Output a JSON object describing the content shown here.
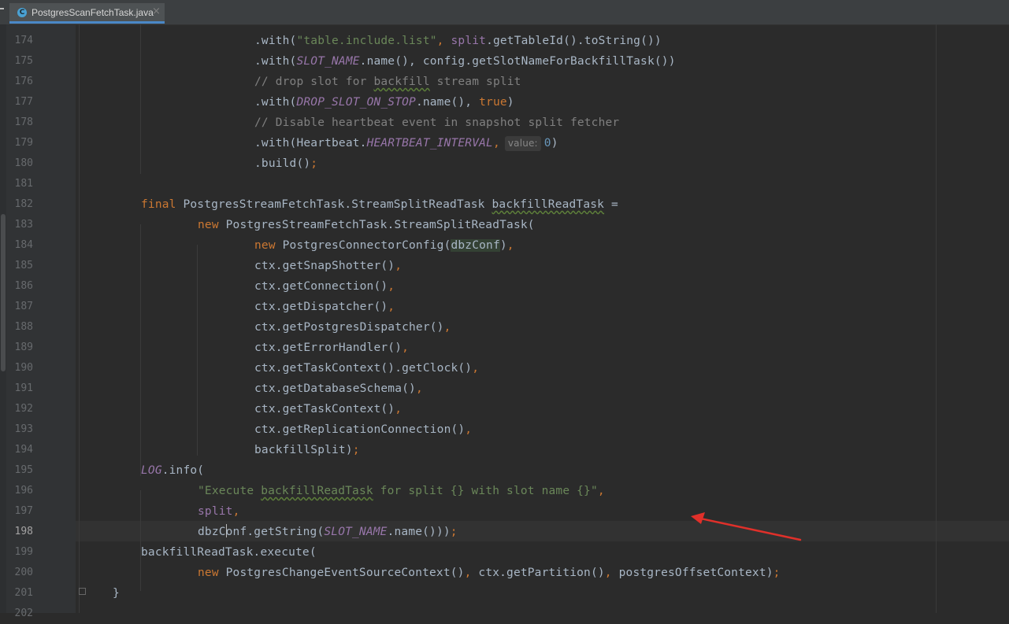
{
  "tab": {
    "title": "PostgresScanFetchTask.java",
    "close": "×",
    "icon_letter": "C"
  },
  "line_numbers": [
    "174",
    "175",
    "176",
    "177",
    "178",
    "179",
    "180",
    "181",
    "182",
    "183",
    "184",
    "185",
    "186",
    "187",
    "188",
    "189",
    "190",
    "191",
    "192",
    "193",
    "194",
    "195",
    "196",
    "197",
    "198",
    "199",
    "200",
    "201",
    "202"
  ],
  "current_line": "198",
  "code": {
    "l174": {
      "a": ".with(",
      "b": "\"table.include.list\"",
      "c": ", ",
      "d": "split",
      "e": ".getTableId().toString())"
    },
    "l175": {
      "a": ".with(",
      "b": "SLOT_NAME",
      "c": ".name(), config.getSlotNameForBackfillTask())"
    },
    "l176": {
      "a": "// drop slot for ",
      "b": "backfill",
      "c": " stream split"
    },
    "l177": {
      "a": ".with(",
      "b": "DROP_SLOT_ON_STOP",
      "c": ".name(), ",
      "d": "true",
      "e": ")"
    },
    "l178": {
      "a": "// Disable heartbeat event in snapshot split fetcher"
    },
    "l179": {
      "a": ".with(Heartbeat.",
      "b": "HEARTBEAT_INTERVAL",
      "c": ",",
      "hint": "value:",
      "d": "0",
      "e": ")"
    },
    "l180": {
      "a": ".build()",
      "b": ";"
    },
    "l182": {
      "a": "final ",
      "b": "PostgresStreamFetchTask.StreamSplitReadTask ",
      "c": "backfillReadTask",
      "d": " ="
    },
    "l183": {
      "a": "new ",
      "b": "PostgresStreamFetchTask.StreamSplitReadTask("
    },
    "l184": {
      "a": "new ",
      "b": "PostgresConnectorConfig(",
      "c": "dbzConf",
      "d": ")",
      "e": ","
    },
    "l185": {
      "a": "ctx.getSnapShotter()",
      "b": ","
    },
    "l186": {
      "a": "ctx.getConnection()",
      "b": ","
    },
    "l187": {
      "a": "ctx.getDispatcher()",
      "b": ","
    },
    "l188": {
      "a": "ctx.getPostgresDispatcher()",
      "b": ","
    },
    "l189": {
      "a": "ctx.getErrorHandler()",
      "b": ","
    },
    "l190": {
      "a": "ctx.getTaskContext().getClock()",
      "b": ","
    },
    "l191": {
      "a": "ctx.getDatabaseSchema()",
      "b": ","
    },
    "l192": {
      "a": "ctx.getTaskContext()",
      "b": ","
    },
    "l193": {
      "a": "ctx.getReplicationConnection()",
      "b": ","
    },
    "l194": {
      "a": "backfillSplit)",
      "b": ";"
    },
    "l195": {
      "a": "LOG",
      "b": ".info("
    },
    "l196": {
      "a": "\"Execute ",
      "b": "backfillReadTask",
      "c": " for split {} with slot name {}\"",
      "d": ","
    },
    "l197": {
      "a": "split",
      "b": ","
    },
    "l198": {
      "a": "dbzC",
      "b": "onf.getString(",
      "c": "SLOT_NAME",
      "d": ".name()))",
      "e": ";"
    },
    "l199": {
      "a": "backfillReadTask.execute("
    },
    "l200": {
      "a": "new ",
      "b": "PostgresChangeEventSourceContext()",
      "c": ", ",
      "d": "ctx.getPartition()",
      "e": ", ",
      "f": "postgresOffsetContext)",
      "g": ";"
    },
    "l201": {
      "a": "}"
    }
  },
  "colors": {
    "background": "#2b2b2b",
    "keyword": "#cc7832",
    "string": "#6a8759",
    "comment": "#808080",
    "constant": "#9876aa",
    "text": "#a9b7c6",
    "annotation_arrow": "#e0302a"
  }
}
